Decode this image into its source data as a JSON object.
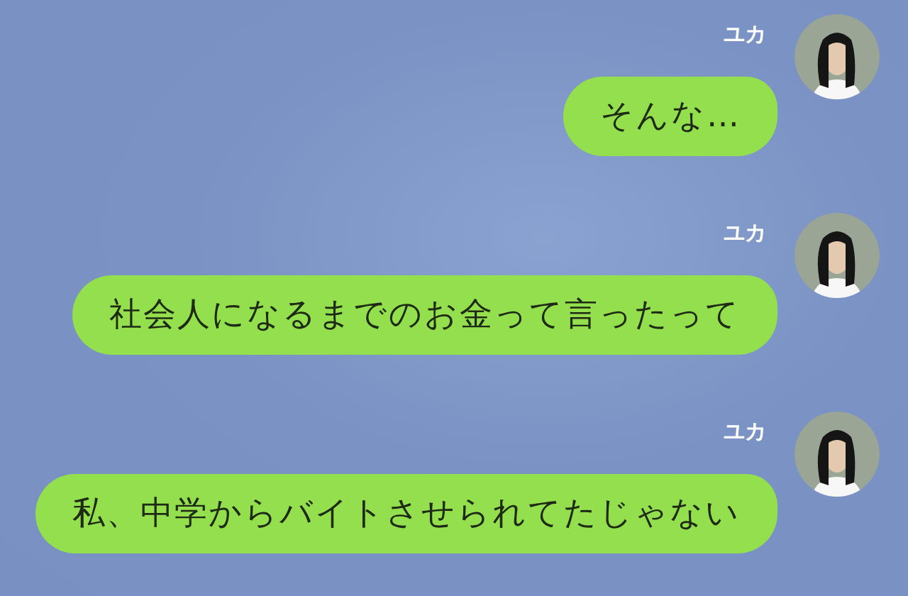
{
  "messages": [
    {
      "sender": "ユカ",
      "text": "そんな…"
    },
    {
      "sender": "ユカ",
      "text": "社会人になるまでのお金って言ったって"
    },
    {
      "sender": "ユカ",
      "text": "私、中学からバイトさせられてたじゃない"
    }
  ]
}
